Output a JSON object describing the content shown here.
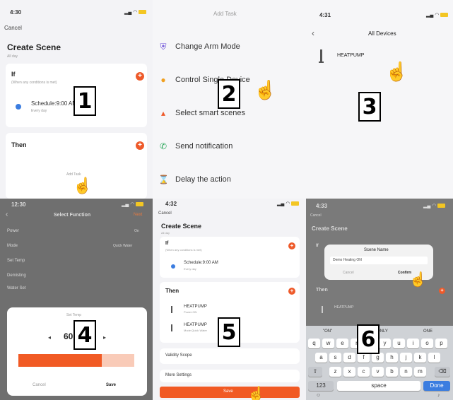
{
  "panel1": {
    "time": "4:30",
    "cancel": "Cancel",
    "title": "Create Scene",
    "subtitle": "All day",
    "if_label": "If",
    "if_hint": "(When any conditions is met)",
    "schedule": "Schedule:9:00 AM",
    "schedule_sub": "Every day",
    "then_label": "Then",
    "add_task": "Add Task",
    "step": "1"
  },
  "panel2": {
    "header": "Add Task",
    "items": [
      {
        "label": "Change Arm Mode",
        "icon": "shield-icon",
        "color": "#6b4fd8"
      },
      {
        "label": "Control Single Device",
        "icon": "bulb-icon",
        "color": "#f0a020"
      },
      {
        "label": "Select smart scenes",
        "icon": "scene-icon",
        "color": "#ee5a2a"
      },
      {
        "label": "Send notification",
        "icon": "bell-icon",
        "color": "#2aa85a"
      },
      {
        "label": "Delay the action",
        "icon": "hourglass-icon",
        "color": "#3b7de0"
      }
    ],
    "step": "2"
  },
  "panel3": {
    "time": "4:31",
    "title": "All Devices",
    "device": "HEATPUMP",
    "step": "3"
  },
  "panel4": {
    "time": "12:30",
    "title": "Select Function",
    "next": "Next",
    "rows": [
      {
        "label": "Power",
        "value": "On"
      },
      {
        "label": "Mode",
        "value": "Quick Water"
      },
      {
        "label": "Set Temp",
        "value": ""
      },
      {
        "label": "Demisting",
        "value": ""
      },
      {
        "label": "Water Set",
        "value": ""
      }
    ],
    "picker_title": "Set Temp",
    "value": "60",
    "cancel": "Cancel",
    "save": "Save",
    "step": "4"
  },
  "panel5": {
    "time": "4:32",
    "cancel": "Cancel",
    "title": "Create Scene",
    "subtitle": "All day",
    "if_label": "If",
    "if_hint": "(When any conditions is met)",
    "schedule": "Schedule:9:00 AM",
    "schedule_sub": "Every day",
    "then_label": "Then",
    "tasks": [
      {
        "name": "HEATPUMP",
        "sub": "Power:ON"
      },
      {
        "name": "HEATPUMP",
        "sub": "Mode:Quick Water"
      }
    ],
    "validity": "Validity Scope",
    "more": "More Settings",
    "save": "Save",
    "step": "5"
  },
  "panel6": {
    "time": "4:33",
    "cancel": "Cancel",
    "title": "Create Scene",
    "if_label": "If",
    "then_label": "Then",
    "task": "HEATPUMP",
    "dialog_title": "Scene Name",
    "dialog_value": "Demo Heating ON",
    "dialog_cancel": "Cancel",
    "dialog_confirm": "Confirm",
    "suggestions": [
      "\"ON\"",
      "ONLY",
      "ONE"
    ],
    "keys_row1": [
      "q",
      "w",
      "e",
      "r",
      "t",
      "y",
      "u",
      "i",
      "o",
      "p"
    ],
    "keys_row2": [
      "a",
      "s",
      "d",
      "f",
      "g",
      "h",
      "j",
      "k",
      "l"
    ],
    "keys_row3": [
      "z",
      "x",
      "c",
      "v",
      "b",
      "n",
      "m"
    ],
    "key_123": "123",
    "key_space": "space",
    "key_done": "Done",
    "step": "6"
  },
  "colors": {
    "accent": "#ee5a2a",
    "purple": "#6b4fd8"
  }
}
